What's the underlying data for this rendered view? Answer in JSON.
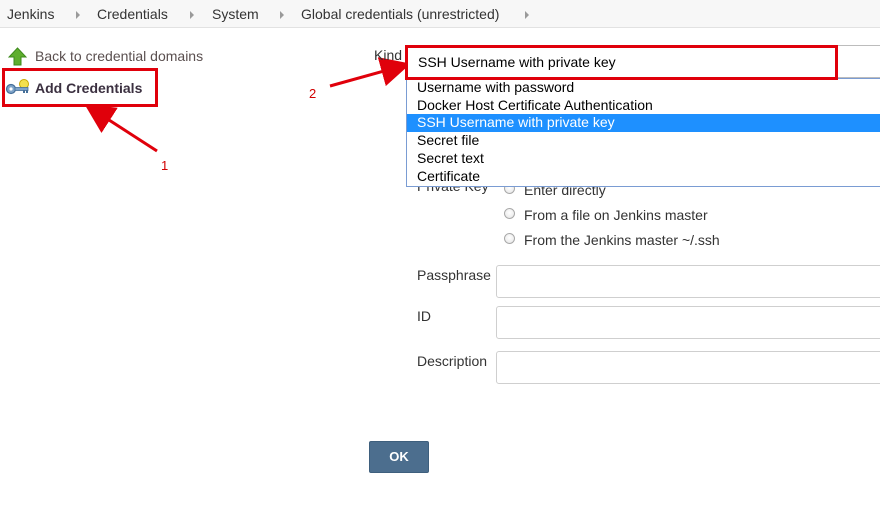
{
  "breadcrumb": {
    "items": [
      "Jenkins",
      "Credentials",
      "System",
      "Global credentials (unrestricted)"
    ]
  },
  "sidebar": {
    "back_label": "Back to credential domains",
    "back_icon": "green-up-arrow-icon",
    "add_label": "Add Credentials",
    "add_icon": "key-icon"
  },
  "annotations": {
    "label_1": "1",
    "label_2": "2",
    "color": "#e0000b"
  },
  "form": {
    "kind_label": "Kind",
    "kind_selected": "SSH Username with private key",
    "kind_options": [
      "Username with password",
      "Docker Host Certificate Authentication",
      "SSH Username with private key",
      "Secret file",
      "Secret text",
      "Certificate"
    ],
    "kind_highlighted_index": 2,
    "private_key_label": "Private Key",
    "private_key_options": [
      "Enter directly",
      "From a file on Jenkins master",
      "From the Jenkins master ~/.ssh"
    ],
    "passphrase_label": "Passphrase",
    "passphrase_value": "",
    "id_label": "ID",
    "id_value": "",
    "description_label": "Description",
    "description_value": "",
    "ok_label": "OK"
  },
  "colors": {
    "highlight": "#1e90ff",
    "ok_button": "#4c6e8e",
    "annotation_red": "#e0000b"
  }
}
